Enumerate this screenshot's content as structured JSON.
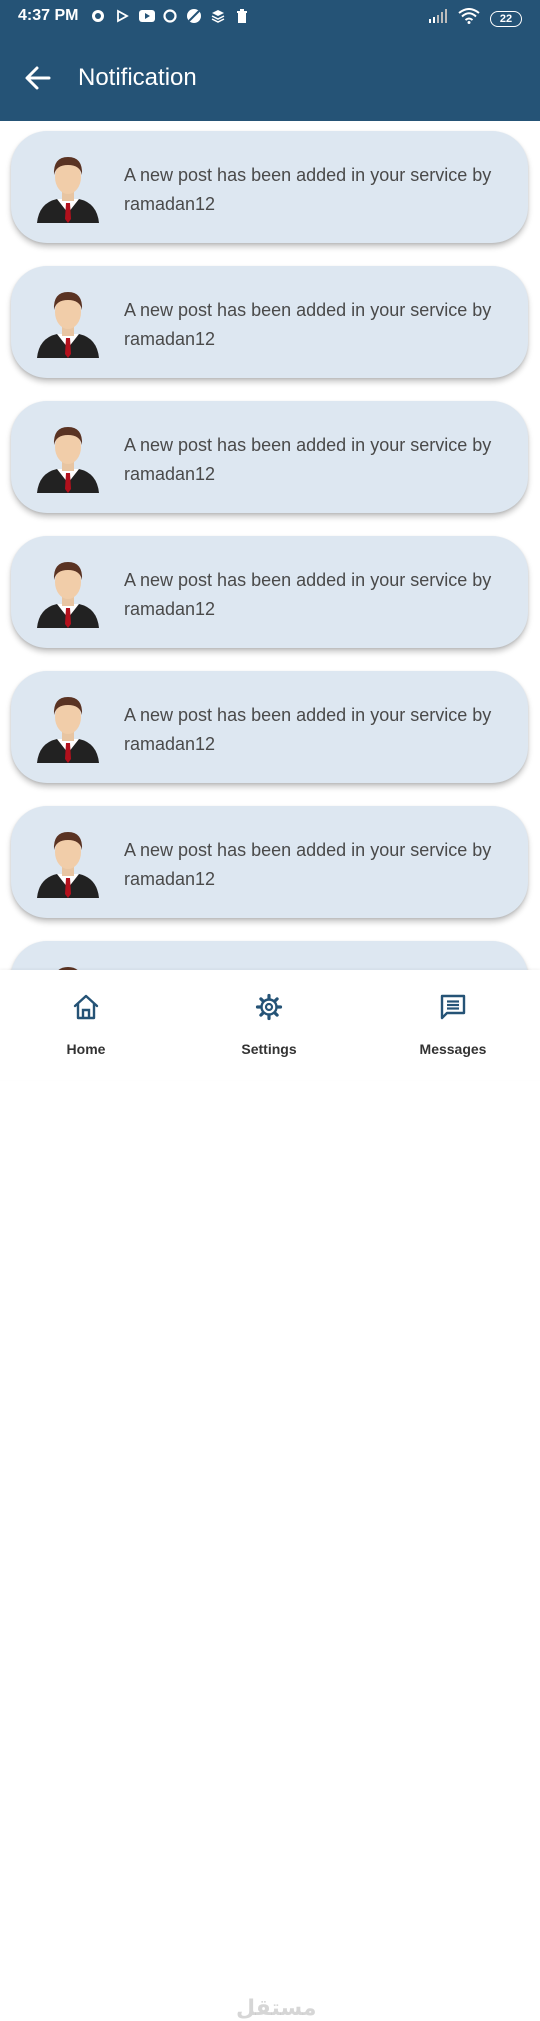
{
  "status_bar": {
    "time": "4:37 PM",
    "battery": "22"
  },
  "app_bar": {
    "title": "Notification"
  },
  "notifications": [
    {
      "text": "A new post has been added in your service by ramadan12"
    },
    {
      "text": "A new post has been added in your service by ramadan12"
    },
    {
      "text": "A new post has been added in your service by ramadan12"
    },
    {
      "text": "A new post has been added in your service by ramadan12"
    },
    {
      "text": "A new post has been added in your service by ramadan12"
    },
    {
      "text": "A new post has been added in your service by ramadan12"
    },
    {
      "text": ""
    }
  ],
  "bottom_nav": {
    "items": [
      {
        "label": "Home",
        "icon": "home-icon"
      },
      {
        "label": "Settings",
        "icon": "gear-icon"
      },
      {
        "label": "Messages",
        "icon": "message-icon"
      }
    ]
  },
  "watermark": "مستقل",
  "colors": {
    "header": "#255376",
    "card": "#dde7f1",
    "nav_icon": "#255376"
  }
}
